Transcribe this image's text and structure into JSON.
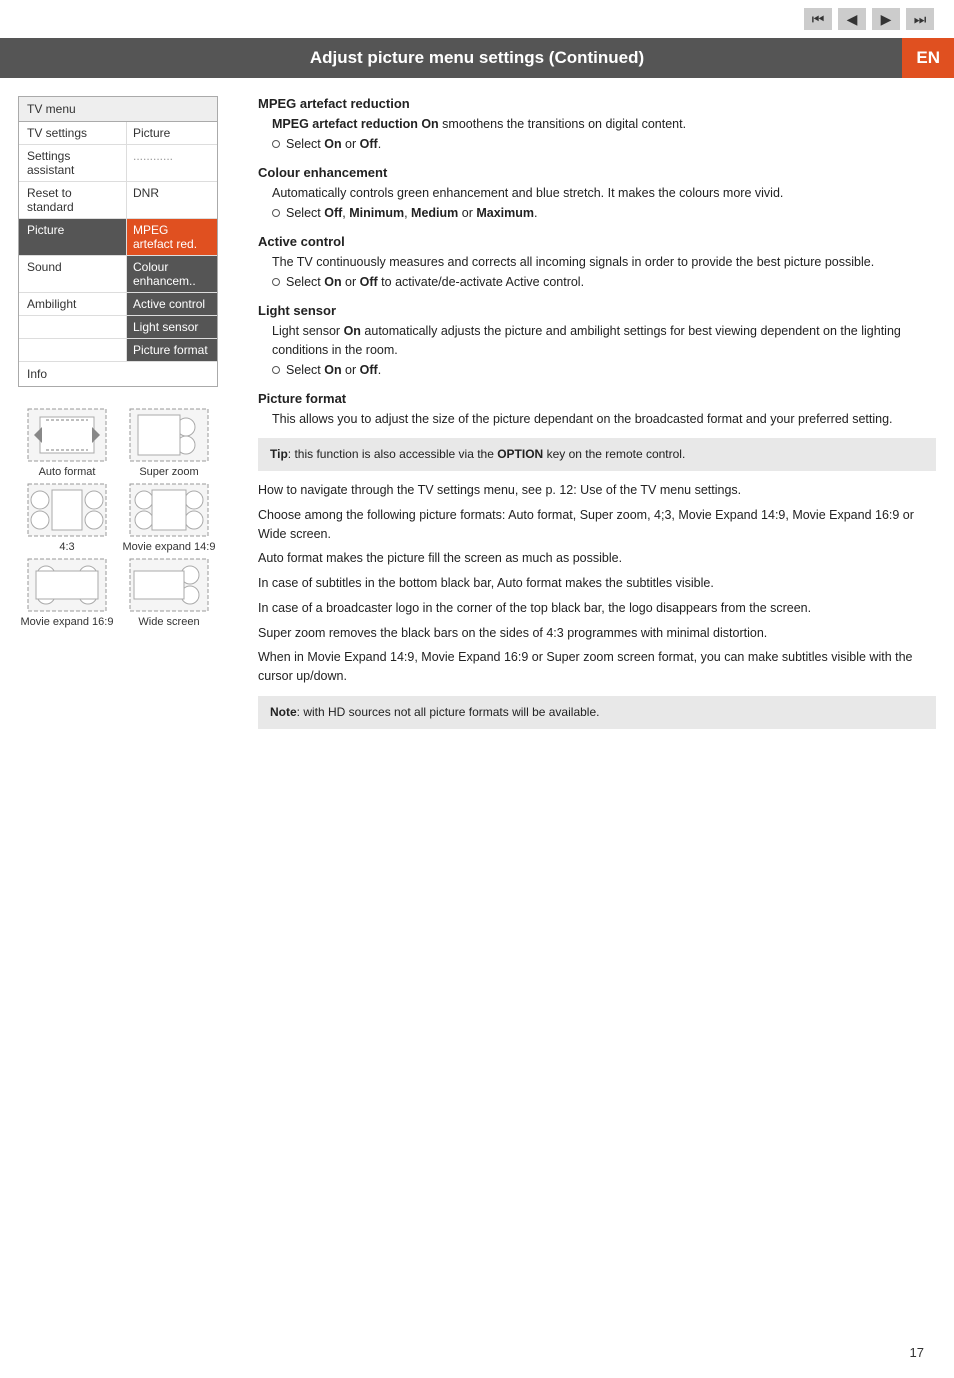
{
  "header": {
    "nav_buttons": [
      "⏮",
      "◀",
      "▶",
      "⏭"
    ],
    "title": "Adjust picture menu settings  (Continued)",
    "lang_badge": "EN"
  },
  "tv_menu": {
    "title": "TV menu",
    "rows": [
      {
        "label": "TV settings",
        "value": "Picture",
        "label_hl": false,
        "value_hl": false
      },
      {
        "label": "Settings assistant",
        "value": "............",
        "label_hl": false,
        "value_hl": false
      },
      {
        "label": "Reset to standard",
        "value": "DNR",
        "label_hl": false,
        "value_hl": false
      },
      {
        "label": "Picture",
        "value": "MPEG artefact red.",
        "label_hl": true,
        "value_hl": true
      },
      {
        "label": "Sound",
        "value": "Colour enhancem..",
        "label_hl": false,
        "value_hl": false
      },
      {
        "label": "Ambilight",
        "value": "Active control",
        "label_hl": false,
        "value_hl": false
      },
      {
        "label": "",
        "value": "Light sensor",
        "label_hl": false,
        "value_hl": false
      },
      {
        "label": "",
        "value": "Picture format",
        "label_hl": false,
        "value_hl": false
      }
    ],
    "info_row": "Info"
  },
  "sections": [
    {
      "id": "mpeg",
      "title": "MPEG artefact reduction",
      "body": "MPEG artefact reduction On smoothens the transitions on digital content.",
      "bullet": "Select On or Off."
    },
    {
      "id": "colour",
      "title": "Colour enhancement",
      "body": "Automatically controls green enhancement and blue stretch. It makes the colours more vivid.",
      "bullet": "Select Off, Minimum, Medium or Maximum."
    },
    {
      "id": "active",
      "title": "Active control",
      "body": "The TV continuously measures and corrects all incoming signals in order to provide the best picture possible.",
      "bullet": "Select On or Off to activate/de-activate Active control."
    },
    {
      "id": "light",
      "title": "Light sensor",
      "body": "Light sensor On automatically adjusts the picture and ambilight settings for best viewing dependent on the lighting conditions in the room.",
      "bullet": "Select On or Off."
    },
    {
      "id": "picture_format",
      "title": "Picture format",
      "body": "This allows you to adjust the size of the picture dependant on the broadcasted format and your preferred setting.",
      "tip": "Tip: this function is also accessible via the OPTION key on the remote control.",
      "description_para1": "How to navigate through the TV settings menu, see p. 12: Use of the TV menu settings.",
      "description_para2": "Choose among the following picture formats: Auto format, Super zoom, 4;3, Movie Expand 14:9, Movie Expand 16:9 or Wide screen.",
      "description_para3": "Auto format makes the picture fill the screen as much as possible.",
      "description_para4": "In case of subtitles in the bottom black bar, Auto format makes the subtitles visible.",
      "description_para5": "In case of a broadcaster logo in the corner of the top black bar, the logo disappears from the screen.",
      "description_para6": "Super zoom removes the black bars on the sides of 4:3 programmes with minimal distortion.",
      "description_para7": "When in Movie Expand 14:9, Movie Expand 16:9 or Super zoom screen format, you can make subtitles visible with the cursor up/down.",
      "note": "Note: with HD sources not all picture formats will be available."
    }
  ],
  "diagrams": [
    {
      "id": "auto_format",
      "label": "Auto format"
    },
    {
      "id": "super_zoom",
      "label": "Super zoom"
    },
    {
      "id": "four_three",
      "label": "4:3"
    },
    {
      "id": "movie_expand_149",
      "label": "Movie expand 14:9"
    },
    {
      "id": "movie_expand_169",
      "label": "Movie expand 16:9"
    },
    {
      "id": "wide_screen",
      "label": "Wide screen"
    }
  ],
  "page_number": "17"
}
